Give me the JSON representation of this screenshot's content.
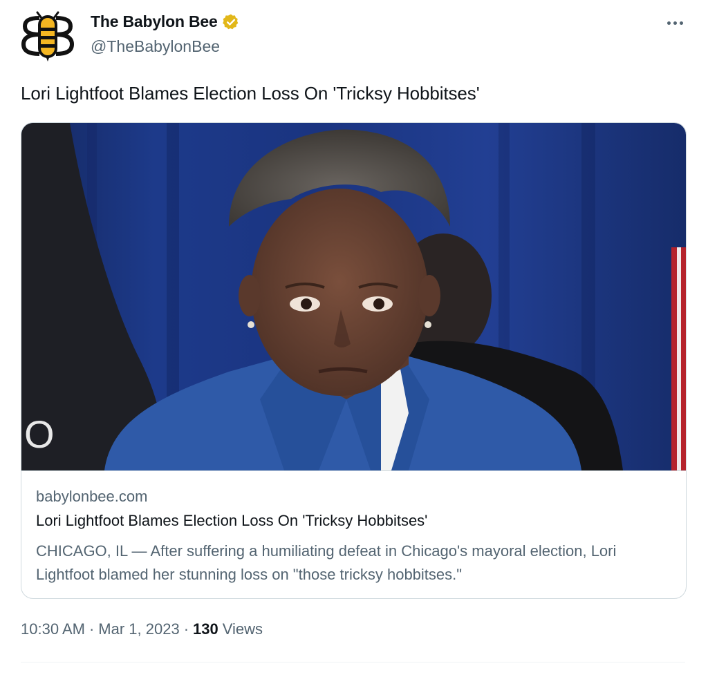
{
  "author": {
    "display_name": "The Babylon Bee",
    "handle": "@TheBabylonBee",
    "verified_badge_color": "#e2b719",
    "avatar_icon": "babylon-bee-logo"
  },
  "tweet": {
    "text": "Lori Lightfoot Blames Election Loss On 'Tricksy Hobbitses'",
    "more_icon": "more-horizontal-icon"
  },
  "card": {
    "domain": "babylonbee.com",
    "title": "Lori Lightfoot Blames Election Loss On 'Tricksy Hobbitses'",
    "description": "CHICAGO, IL — After suffering a humiliating defeat in Chicago's mayoral election, Lori Lightfoot blamed her stunning loss on \"those tricksy hobbitses.\"",
    "image_subject": "photo of a woman in a blue blazer in front of a blue curtain"
  },
  "meta": {
    "time": "10:30 AM",
    "date": "Mar 1, 2023",
    "separator": "·",
    "views_count": "130",
    "views_label": "Views"
  },
  "colors": {
    "text_primary": "#0f1419",
    "text_secondary": "#536471",
    "border": "#cfd9de"
  }
}
